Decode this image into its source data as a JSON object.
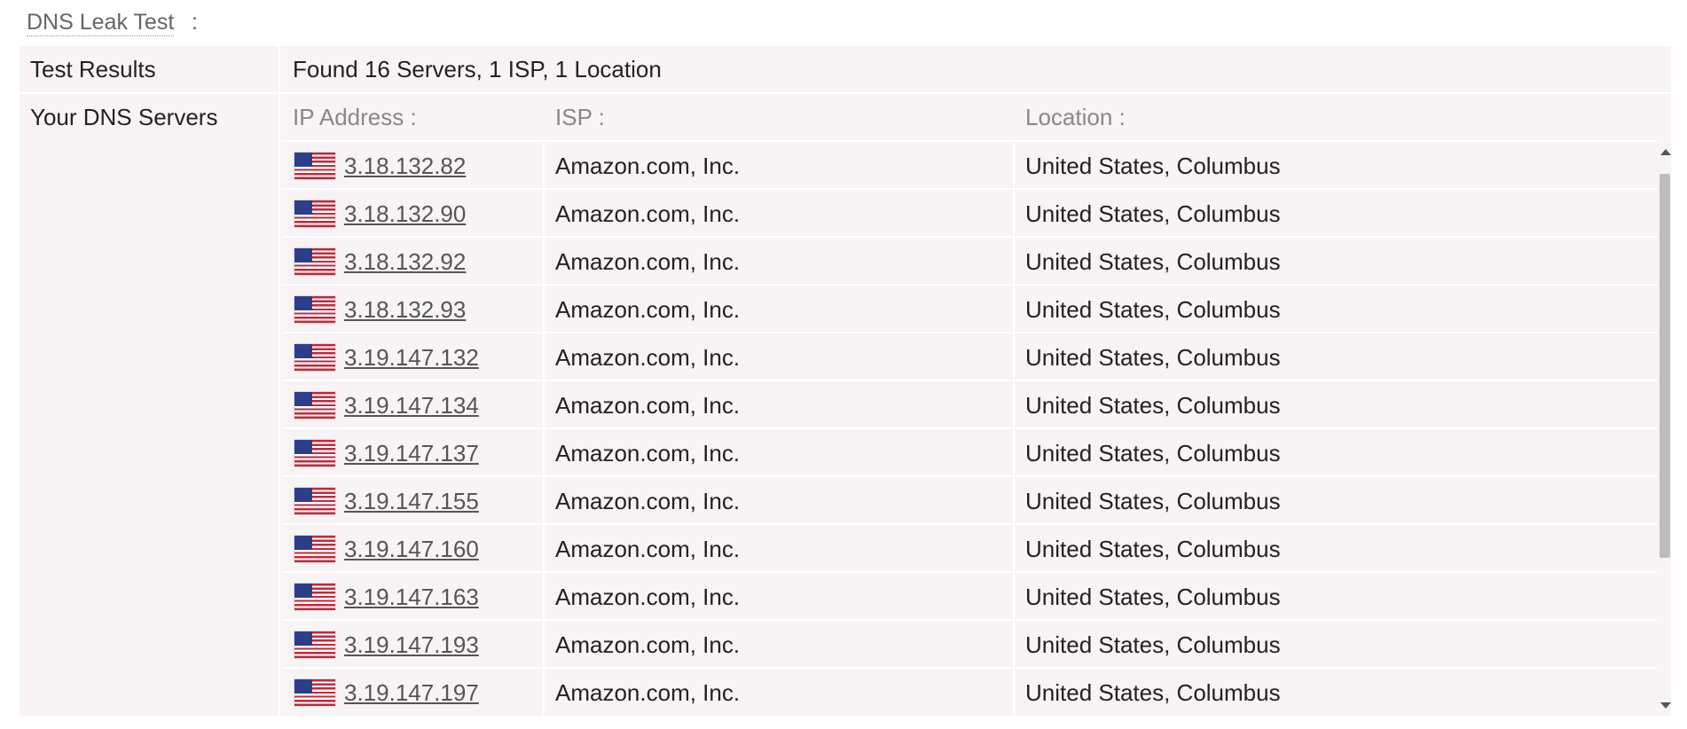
{
  "section": {
    "title": "DNS Leak Test",
    "colon": ":"
  },
  "results": {
    "label": "Test Results",
    "value": "Found 16 Servers, 1 ISP, 1 Location"
  },
  "dns": {
    "label": "Your DNS Servers",
    "headers": {
      "ip": "IP Address :",
      "isp": "ISP :",
      "location": "Location :"
    },
    "rows": [
      {
        "ip": "3.18.132.82",
        "isp": "Amazon.com, Inc.",
        "location": "United States, Columbus",
        "flag": "us-flag-icon"
      },
      {
        "ip": "3.18.132.90",
        "isp": "Amazon.com, Inc.",
        "location": "United States, Columbus",
        "flag": "us-flag-icon"
      },
      {
        "ip": "3.18.132.92",
        "isp": "Amazon.com, Inc.",
        "location": "United States, Columbus",
        "flag": "us-flag-icon"
      },
      {
        "ip": "3.18.132.93",
        "isp": "Amazon.com, Inc.",
        "location": "United States, Columbus",
        "flag": "us-flag-icon"
      },
      {
        "ip": "3.19.147.132",
        "isp": "Amazon.com, Inc.",
        "location": "United States, Columbus",
        "flag": "us-flag-icon"
      },
      {
        "ip": "3.19.147.134",
        "isp": "Amazon.com, Inc.",
        "location": "United States, Columbus",
        "flag": "us-flag-icon"
      },
      {
        "ip": "3.19.147.137",
        "isp": "Amazon.com, Inc.",
        "location": "United States, Columbus",
        "flag": "us-flag-icon"
      },
      {
        "ip": "3.19.147.155",
        "isp": "Amazon.com, Inc.",
        "location": "United States, Columbus",
        "flag": "us-flag-icon"
      },
      {
        "ip": "3.19.147.160",
        "isp": "Amazon.com, Inc.",
        "location": "United States, Columbus",
        "flag": "us-flag-icon"
      },
      {
        "ip": "3.19.147.163",
        "isp": "Amazon.com, Inc.",
        "location": "United States, Columbus",
        "flag": "us-flag-icon"
      },
      {
        "ip": "3.19.147.193",
        "isp": "Amazon.com, Inc.",
        "location": "United States, Columbus",
        "flag": "us-flag-icon"
      },
      {
        "ip": "3.19.147.197",
        "isp": "Amazon.com, Inc.",
        "location": "United States, Columbus",
        "flag": "us-flag-icon"
      }
    ]
  },
  "colors": {
    "panel_bg": "#f8f3f5",
    "link": "#555555",
    "header_text": "#888888"
  }
}
